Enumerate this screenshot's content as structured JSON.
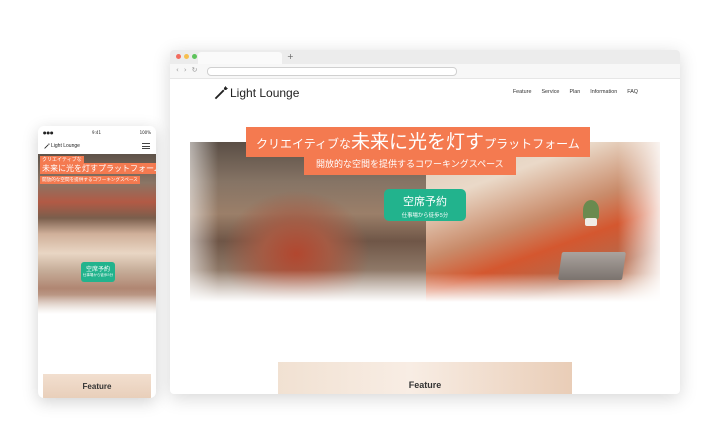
{
  "brand": {
    "name": "Light Lounge",
    "accent": "#f47a50",
    "cta_color": "#22b38d"
  },
  "nav": {
    "items": [
      "Feature",
      "Service",
      "Plan",
      "Information",
      "FAQ"
    ]
  },
  "hero": {
    "line1_pre": "クリエイティブな",
    "line1_big": "未来に光を灯す",
    "line1_post": "プラットフォーム",
    "line2": "開放的な空間を提供するコワーキングスペース",
    "cta_main": "空席予約",
    "cta_sub": "仕事場から徒歩5分"
  },
  "sections": {
    "feature_title": "Feature"
  },
  "mobile": {
    "hero_line1": "クリエイティブな",
    "hero_line2": "未来に光を灯すプラットフォーム",
    "hero_line3": "開放的な空間を提供するコワーキングスペース",
    "cta_main": "空席予約",
    "cta_sub": "仕事場から徒歩5分",
    "status_time": "9:41",
    "status_battery": "100%"
  },
  "browser": {
    "new_tab": "+"
  },
  "icons": [
    "logo-wand-icon",
    "menu-icon",
    "back-icon",
    "forward-icon",
    "reload-icon"
  ]
}
